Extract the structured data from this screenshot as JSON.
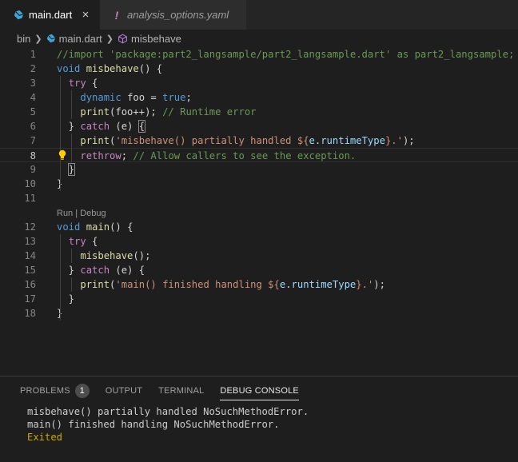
{
  "tabs": [
    {
      "label": "main.dart",
      "active": true,
      "icon": "dart-icon",
      "close": "×"
    },
    {
      "label": "analysis_options.yaml",
      "active": false,
      "icon": "warning-bang-icon",
      "icon_text": "!"
    }
  ],
  "breadcrumb": {
    "folder": "bin",
    "file": "main.dart",
    "symbol": "misbehave"
  },
  "editor": {
    "line_numbers": [
      "1",
      "2",
      "3",
      "4",
      "5",
      "6",
      "7",
      "8",
      "9",
      "10",
      "11",
      "12",
      "13",
      "14",
      "15",
      "16",
      "17",
      "18"
    ],
    "codelens": "Run | Debug",
    "lines": [
      [
        {
          "t": "//import 'package:part2_langsample/part2_langsample.dart' as part2_langsample;",
          "c": "cm"
        }
      ],
      [
        {
          "t": "void",
          "c": "kw"
        },
        {
          "t": " "
        },
        {
          "t": "misbehave",
          "c": "fn"
        },
        {
          "t": "() {"
        }
      ],
      [
        {
          "t": "  "
        },
        {
          "t": "try",
          "c": "ctl"
        },
        {
          "t": " {"
        }
      ],
      [
        {
          "t": "    "
        },
        {
          "t": "dynamic",
          "c": "kw"
        },
        {
          "t": " foo = "
        },
        {
          "t": "true",
          "c": "kw"
        },
        {
          "t": ";"
        }
      ],
      [
        {
          "t": "    "
        },
        {
          "t": "print",
          "c": "fn"
        },
        {
          "t": "(foo++); "
        },
        {
          "t": "// Runtime error",
          "c": "cm"
        }
      ],
      [
        {
          "t": "  } "
        },
        {
          "t": "catch",
          "c": "ctl"
        },
        {
          "t": " (e) "
        },
        {
          "t": "{",
          "c": "br"
        }
      ],
      [
        {
          "t": "    "
        },
        {
          "t": "print",
          "c": "fn"
        },
        {
          "t": "("
        },
        {
          "t": "'misbehave() partially handled ${",
          "c": "str"
        },
        {
          "t": "e",
          "c": "var"
        },
        {
          "t": "."
        },
        {
          "t": "runtimeType",
          "c": "var"
        },
        {
          "t": "}.'",
          "c": "str"
        },
        {
          "t": ");"
        }
      ],
      [
        {
          "t": "    "
        },
        {
          "t": "rethrow",
          "c": "ctl"
        },
        {
          "t": "; "
        },
        {
          "t": "// Allow callers to see the exception.",
          "c": "cm"
        }
      ],
      [
        {
          "t": "  "
        },
        {
          "t": "}",
          "c": "br"
        }
      ],
      [
        {
          "t": "}"
        }
      ],
      [
        {
          "t": ""
        }
      ],
      [
        {
          "t": "void",
          "c": "kw"
        },
        {
          "t": " "
        },
        {
          "t": "main",
          "c": "fn"
        },
        {
          "t": "() {"
        }
      ],
      [
        {
          "t": "  "
        },
        {
          "t": "try",
          "c": "ctl"
        },
        {
          "t": " {"
        }
      ],
      [
        {
          "t": "    "
        },
        {
          "t": "misbehave",
          "c": "fn"
        },
        {
          "t": "();"
        }
      ],
      [
        {
          "t": "  } "
        },
        {
          "t": "catch",
          "c": "ctl"
        },
        {
          "t": " (e) {"
        }
      ],
      [
        {
          "t": "    "
        },
        {
          "t": "print",
          "c": "fn"
        },
        {
          "t": "("
        },
        {
          "t": "'main() finished handling ${",
          "c": "str"
        },
        {
          "t": "e",
          "c": "var"
        },
        {
          "t": "."
        },
        {
          "t": "runtimeType",
          "c": "var"
        },
        {
          "t": "}.'",
          "c": "str"
        },
        {
          "t": ");"
        }
      ],
      [
        {
          "t": "  }"
        }
      ],
      [
        {
          "t": "}"
        }
      ]
    ]
  },
  "panel": {
    "tabs": [
      {
        "label": "PROBLEMS",
        "badge": "1"
      },
      {
        "label": "OUTPUT"
      },
      {
        "label": "TERMINAL"
      },
      {
        "label": "DEBUG CONSOLE",
        "active": true
      }
    ],
    "console": [
      {
        "text": "misbehave() partially handled NoSuchMethodError.",
        "kind": "out"
      },
      {
        "text": "main() finished handling NoSuchMethodError.",
        "kind": "out"
      },
      {
        "text": "Exited",
        "kind": "exited"
      }
    ]
  },
  "colors": {
    "background": "#1e1e1e",
    "keyword": "#569cd6",
    "control": "#c586c0",
    "function": "#dcdcaa",
    "string": "#ce9178",
    "comment": "#6a9955",
    "variable": "#9cdcfe",
    "exited": "#cca700",
    "lightbulb": "#ffcc00"
  }
}
